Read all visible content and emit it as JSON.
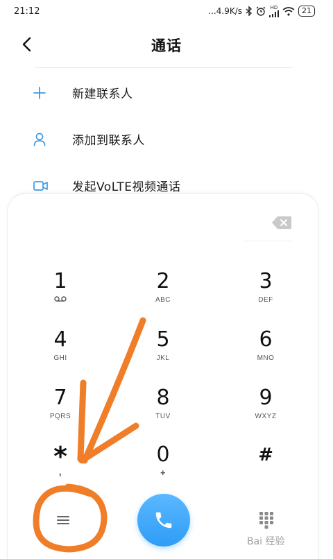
{
  "status_bar": {
    "time": "21:12",
    "network_speed": "...4.9K/s",
    "hd_badge": "HD",
    "battery": "21"
  },
  "header": {
    "title": "通话"
  },
  "menu": {
    "items": [
      {
        "label": "新建联系人",
        "icon": "plus-icon"
      },
      {
        "label": "添加到联系人",
        "icon": "person-icon"
      },
      {
        "label": "发起VoLTE视频通话",
        "icon": "video-camera-icon"
      }
    ]
  },
  "keypad": {
    "keys": [
      {
        "digit": "1",
        "sub": ""
      },
      {
        "digit": "2",
        "sub": "ABC"
      },
      {
        "digit": "3",
        "sub": "DEF"
      },
      {
        "digit": "4",
        "sub": "GHI"
      },
      {
        "digit": "5",
        "sub": "JKL"
      },
      {
        "digit": "6",
        "sub": "MNO"
      },
      {
        "digit": "7",
        "sub": "PQRS"
      },
      {
        "digit": "8",
        "sub": "TUV"
      },
      {
        "digit": "9",
        "sub": "WXYZ"
      },
      {
        "digit": "*",
        "sub": ","
      },
      {
        "digit": "0",
        "sub": "+"
      },
      {
        "digit": "#",
        "sub": ""
      }
    ]
  },
  "colors": {
    "accent": "#2f9cf7",
    "icon_blue": "#3a9be8",
    "annotation_orange": "#f07d28"
  },
  "watermark": "Bai 经验"
}
